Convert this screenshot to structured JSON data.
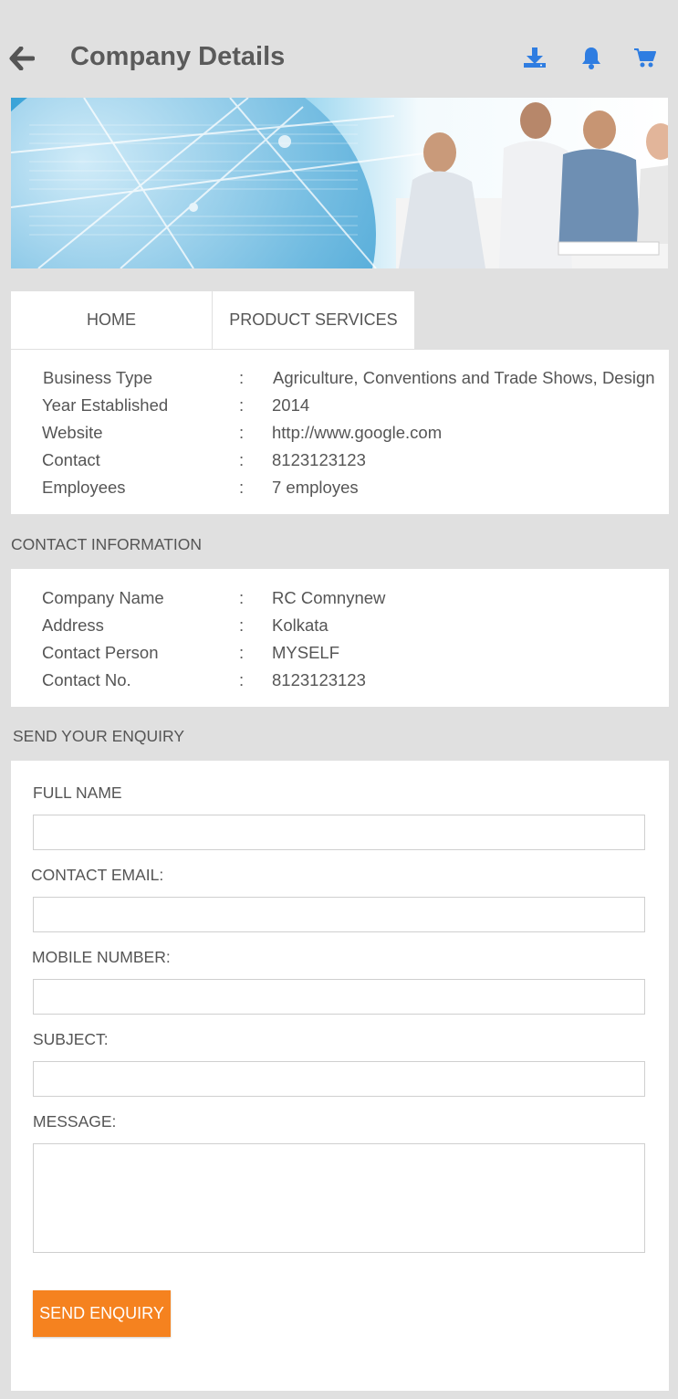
{
  "header": {
    "title": "Company Details",
    "icons": [
      "back-arrow-icon",
      "download-icon",
      "bell-icon",
      "cart-icon"
    ],
    "icon_color": "#2f7de1"
  },
  "tabs": [
    {
      "label": "HOME"
    },
    {
      "label": "PRODUCT SERVICES"
    }
  ],
  "business": {
    "rows": [
      {
        "label": "Business Type",
        "value": "Agriculture, Conventions and Trade Shows, Design"
      },
      {
        "label": "Year Established",
        "value": "2014"
      },
      {
        "label": "Website",
        "value": "http://www.google.com"
      },
      {
        "label": "Contact",
        "value": "8123123123"
      },
      {
        "label": "Employees",
        "value": "7 employes"
      }
    ]
  },
  "contact": {
    "heading": "CONTACT INFORMATION",
    "rows": [
      {
        "label": "Company Name",
        "value": "RC Comnynew"
      },
      {
        "label": "Address",
        "value": "Kolkata"
      },
      {
        "label": "Contact Person",
        "value": "MYSELF"
      },
      {
        "label": "Contact No.",
        "value": "8123123123"
      }
    ]
  },
  "separator": ":",
  "enquiry": {
    "heading": "SEND YOUR ENQUIRY",
    "full_name_label": "FULL NAME",
    "full_name_value": "",
    "email_label": "CONTACT EMAIL:",
    "email_value": "",
    "mobile_label": "MOBILE NUMBER:",
    "mobile_value": "",
    "subject_label": "SUBJECT:",
    "subject_value": "",
    "message_label": "MESSAGE:",
    "message_value": "",
    "submit_label": "SEND ENQUIRY",
    "submit_color": "#f5821f"
  }
}
